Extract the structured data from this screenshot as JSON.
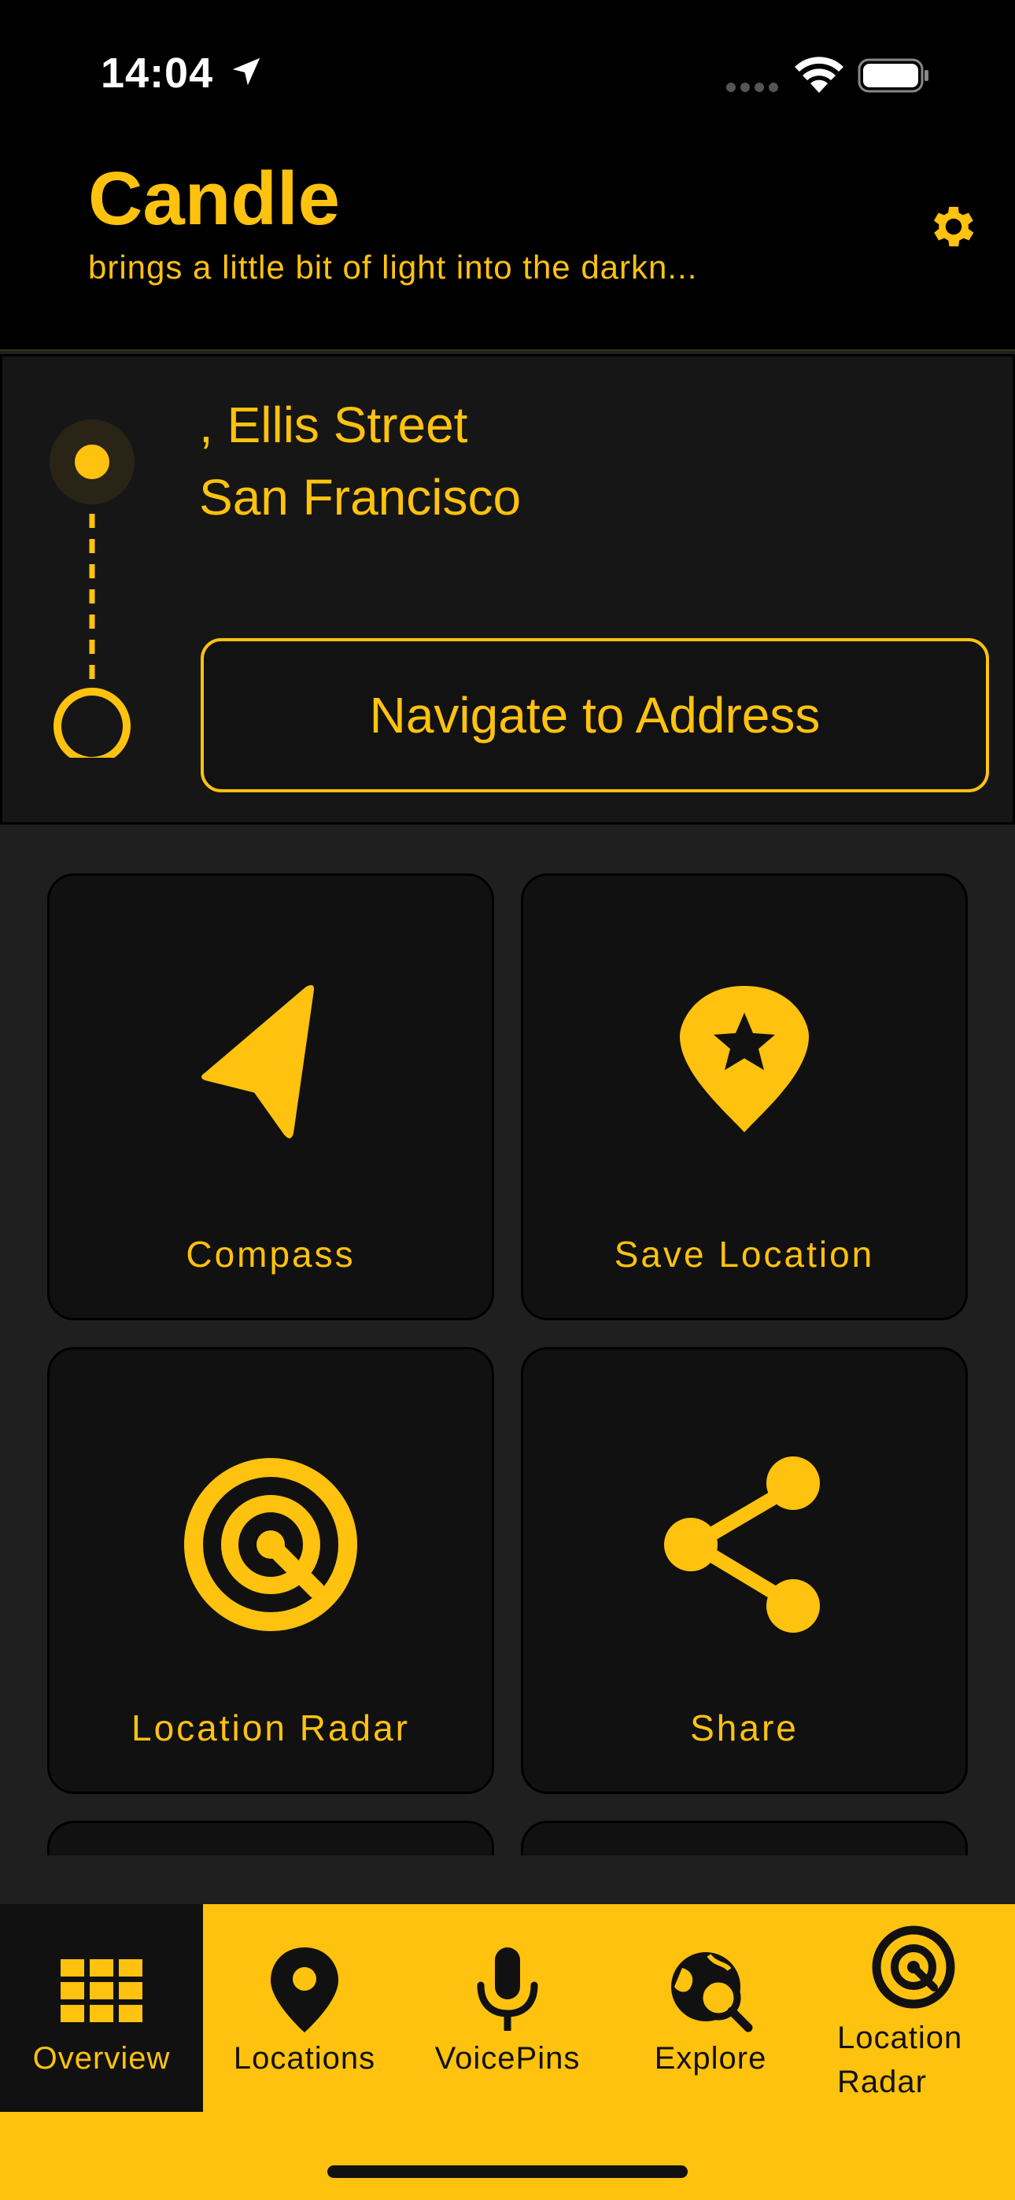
{
  "status": {
    "time": "14:04"
  },
  "header": {
    "title": "Candle",
    "subtitle": "brings a little bit of light into the darkn..."
  },
  "address": {
    "line1": ", Ellis Street",
    "line2": "San Francisco",
    "navigate_label": "Navigate to Address"
  },
  "tiles": [
    {
      "label": "Compass",
      "icon": "compass-arrow-icon"
    },
    {
      "label": "Save Location",
      "icon": "star-pin-icon"
    },
    {
      "label": "Location Radar",
      "icon": "radar-icon"
    },
    {
      "label": "Share",
      "icon": "share-icon"
    }
  ],
  "tabs": [
    {
      "label": "Overview",
      "icon": "grid-icon",
      "active": true
    },
    {
      "label": "Locations",
      "icon": "map-pin-icon"
    },
    {
      "label": "VoicePins",
      "icon": "microphone-icon"
    },
    {
      "label": "Explore",
      "icon": "globe-search-icon"
    },
    {
      "label": "Location Radar",
      "label_lines": [
        "Location",
        "Radar"
      ],
      "icon": "radar-icon"
    }
  ],
  "colors": {
    "accent": "#ffc20e",
    "background": "#1f1f1f",
    "card": "#111111",
    "header": "#000000"
  }
}
